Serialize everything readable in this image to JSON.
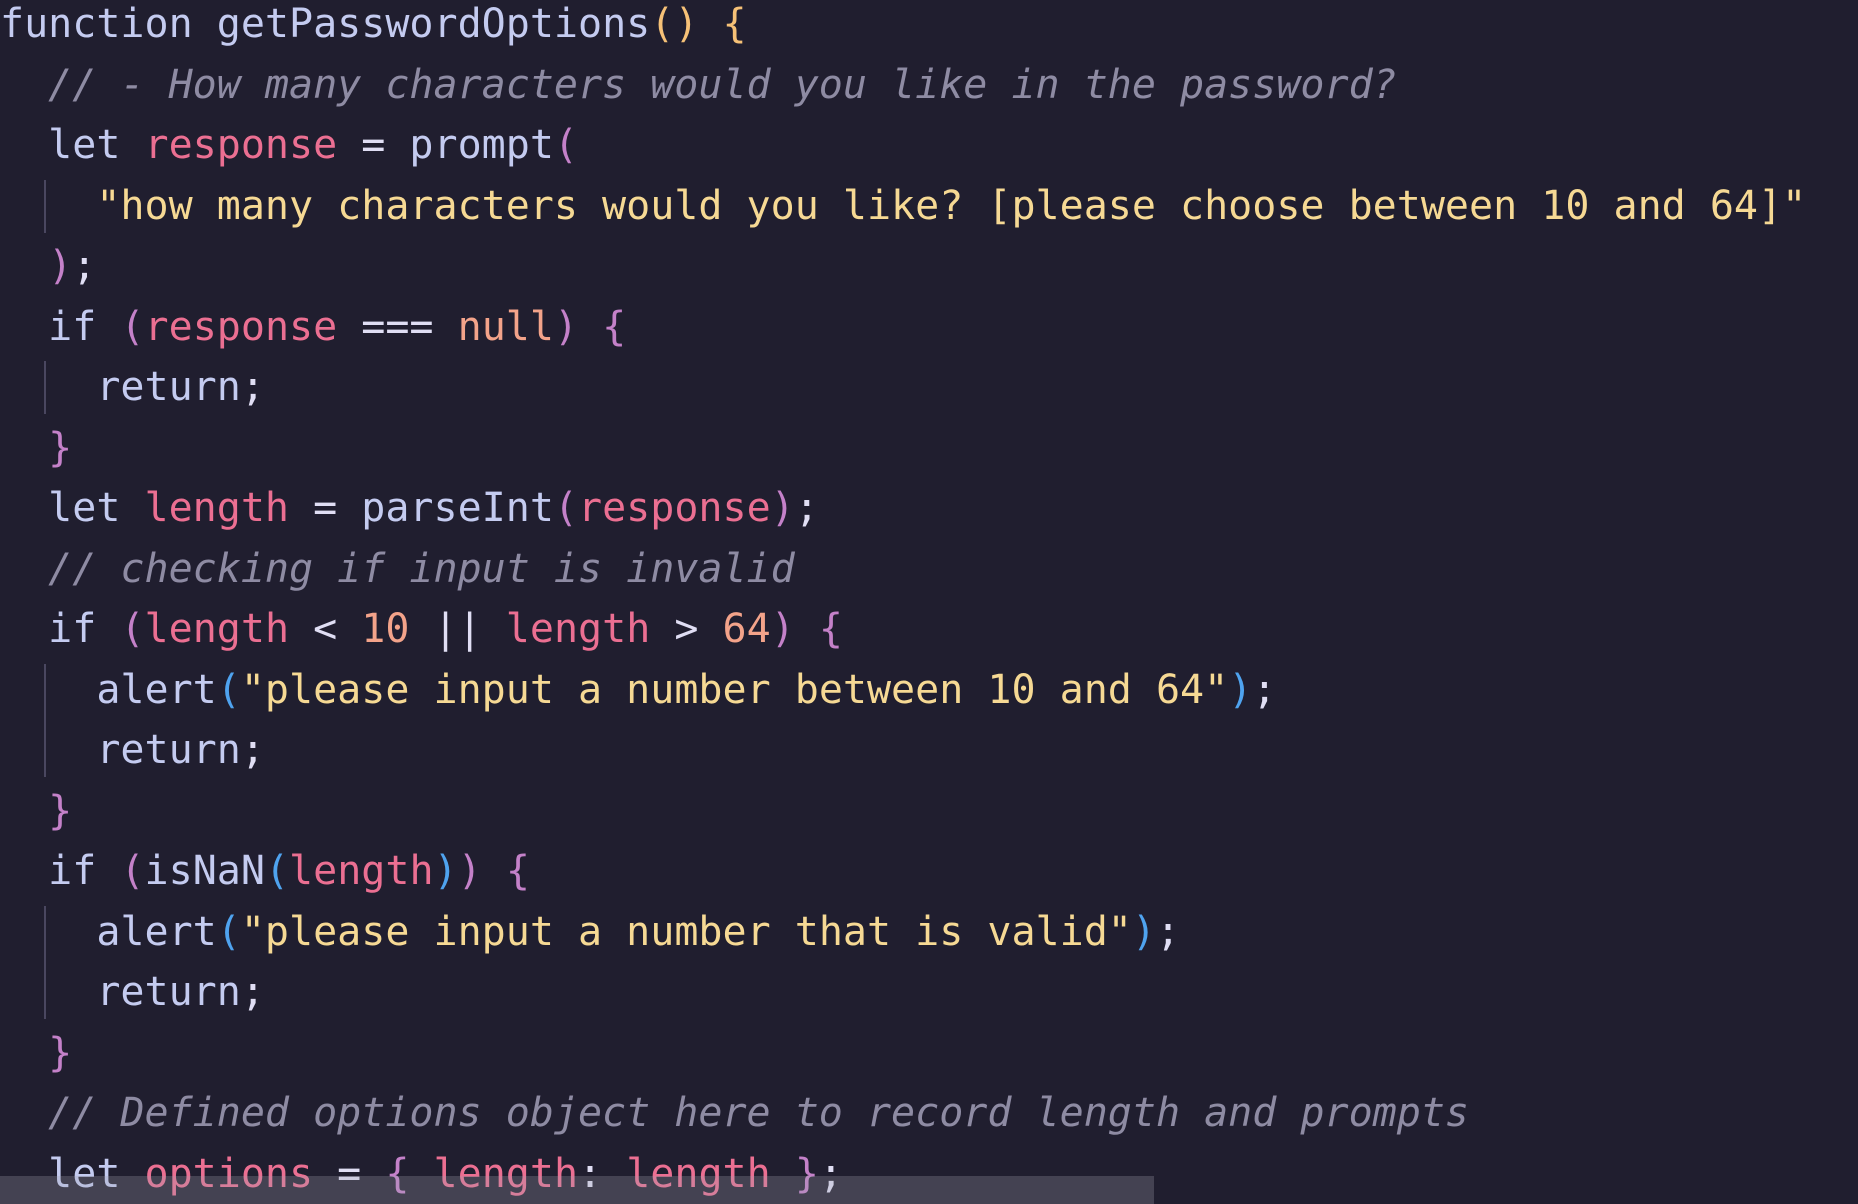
{
  "editor": {
    "lines": [
      {
        "tokens": [
          [
            "function",
            "kw"
          ],
          [
            " ",
            "plain"
          ],
          [
            "getPasswordOptions",
            "fn"
          ],
          [
            "()",
            "p1"
          ],
          [
            " ",
            "plain"
          ],
          [
            "{",
            "p1"
          ]
        ]
      },
      {
        "tokens": [
          [
            "  // - How many characters would you like in the password?",
            "cmt"
          ]
        ]
      },
      {
        "tokens": [
          [
            "  ",
            "plain"
          ],
          [
            "let",
            "kw"
          ],
          [
            " ",
            "plain"
          ],
          [
            "response",
            "var"
          ],
          [
            " = ",
            "op"
          ],
          [
            "prompt",
            "fn"
          ],
          [
            "(",
            "p2"
          ]
        ]
      },
      {
        "tokens": [
          [
            "    ",
            "plain"
          ],
          [
            "\"how many characters would you like? [please choose between 10 and 64]\"",
            "str"
          ]
        ]
      },
      {
        "tokens": [
          [
            "  ",
            "plain"
          ],
          [
            ")",
            "p2"
          ],
          [
            ";",
            "plain"
          ]
        ]
      },
      {
        "tokens": [
          [
            "  ",
            "plain"
          ],
          [
            "if",
            "kw"
          ],
          [
            " ",
            "plain"
          ],
          [
            "(",
            "p2"
          ],
          [
            "response",
            "var"
          ],
          [
            " === ",
            "op"
          ],
          [
            "null",
            "null"
          ],
          [
            ")",
            "p2"
          ],
          [
            " ",
            "plain"
          ],
          [
            "{",
            "p2"
          ]
        ]
      },
      {
        "tokens": [
          [
            "    ",
            "plain"
          ],
          [
            "return",
            "kw"
          ],
          [
            ";",
            "plain"
          ]
        ]
      },
      {
        "tokens": [
          [
            "  ",
            "plain"
          ],
          [
            "}",
            "p2"
          ]
        ]
      },
      {
        "tokens": [
          [
            "  ",
            "plain"
          ],
          [
            "let",
            "kw"
          ],
          [
            " ",
            "plain"
          ],
          [
            "length",
            "var"
          ],
          [
            " = ",
            "op"
          ],
          [
            "parseInt",
            "fn"
          ],
          [
            "(",
            "p2"
          ],
          [
            "response",
            "var"
          ],
          [
            ")",
            "p2"
          ],
          [
            ";",
            "plain"
          ]
        ]
      },
      {
        "tokens": [
          [
            "  // checking if input is invalid",
            "cmt"
          ]
        ]
      },
      {
        "tokens": [
          [
            "  ",
            "plain"
          ],
          [
            "if",
            "kw"
          ],
          [
            " ",
            "plain"
          ],
          [
            "(",
            "p2"
          ],
          [
            "length",
            "var"
          ],
          [
            " < ",
            "op"
          ],
          [
            "10",
            "num"
          ],
          [
            " || ",
            "op"
          ],
          [
            "length",
            "var"
          ],
          [
            " > ",
            "op"
          ],
          [
            "64",
            "num"
          ],
          [
            ")",
            "p2"
          ],
          [
            " ",
            "plain"
          ],
          [
            "{",
            "p2"
          ]
        ]
      },
      {
        "tokens": [
          [
            "    ",
            "plain"
          ],
          [
            "alert",
            "fn"
          ],
          [
            "(",
            "p3"
          ],
          [
            "\"please input a number between 10 and 64\"",
            "str"
          ],
          [
            ")",
            "p3"
          ],
          [
            ";",
            "plain"
          ]
        ]
      },
      {
        "tokens": [
          [
            "    ",
            "plain"
          ],
          [
            "return",
            "kw"
          ],
          [
            ";",
            "plain"
          ]
        ]
      },
      {
        "tokens": [
          [
            "  ",
            "plain"
          ],
          [
            "}",
            "p2"
          ]
        ]
      },
      {
        "tokens": [
          [
            "  ",
            "plain"
          ],
          [
            "if",
            "kw"
          ],
          [
            " ",
            "plain"
          ],
          [
            "(",
            "p2"
          ],
          [
            "isNaN",
            "fn"
          ],
          [
            "(",
            "p3"
          ],
          [
            "length",
            "var"
          ],
          [
            ")",
            "p3"
          ],
          [
            ")",
            "p2"
          ],
          [
            " ",
            "plain"
          ],
          [
            "{",
            "p2"
          ]
        ]
      },
      {
        "tokens": [
          [
            "    ",
            "plain"
          ],
          [
            "alert",
            "fn"
          ],
          [
            "(",
            "p3"
          ],
          [
            "\"please input a number that is valid\"",
            "str"
          ],
          [
            ")",
            "p3"
          ],
          [
            ";",
            "plain"
          ]
        ]
      },
      {
        "tokens": [
          [
            "    ",
            "plain"
          ],
          [
            "return",
            "kw"
          ],
          [
            ";",
            "plain"
          ]
        ]
      },
      {
        "tokens": [
          [
            "  ",
            "plain"
          ],
          [
            "}",
            "p2"
          ]
        ]
      },
      {
        "tokens": [
          [
            "  // Defined options object here to record length and prompts",
            "cmt"
          ]
        ]
      },
      {
        "tokens": [
          [
            "  ",
            "plain"
          ],
          [
            "let",
            "kw"
          ],
          [
            " ",
            "plain"
          ],
          [
            "options",
            "var"
          ],
          [
            " = ",
            "op"
          ],
          [
            "{",
            "p2"
          ],
          [
            " ",
            "plain"
          ],
          [
            "length",
            "var"
          ],
          [
            ":",
            "plain"
          ],
          [
            " ",
            "plain"
          ],
          [
            "length",
            "var"
          ],
          [
            " ",
            "plain"
          ],
          [
            "}",
            "p2"
          ],
          [
            ";",
            "plain"
          ]
        ]
      }
    ]
  },
  "colors": {
    "background": "#201e2f",
    "keyword": "#c4cbf0",
    "variable": "#eb6f92",
    "string": "#f6d994",
    "number": "#f3a38a",
    "comment": "#8e8ba3",
    "bracket_gold": "#f6c177",
    "bracket_purple": "#c481c9",
    "bracket_blue": "#4fa3ef"
  }
}
